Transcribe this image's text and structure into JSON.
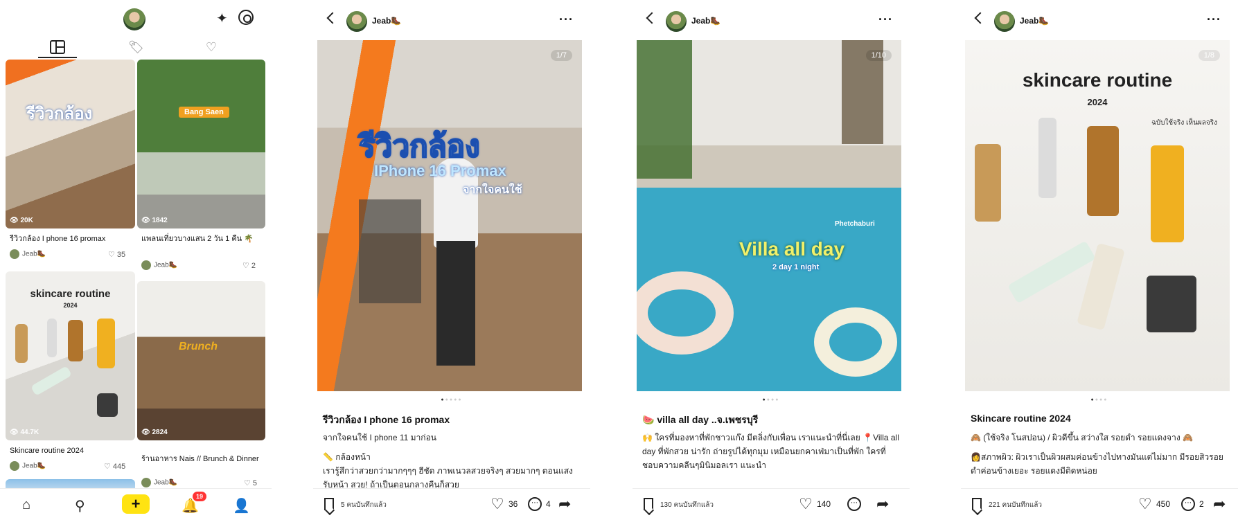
{
  "profile": {
    "tabs": [
      "grid-icon",
      "bookmark-icon",
      "heart-icon"
    ],
    "cards": [
      {
        "title": "รีวิวกล้อง I phone 16 promax",
        "author": "Jeab🥾",
        "likes": "35",
        "views": "20K",
        "overlay": "รีวิวกล้อง"
      },
      {
        "title": "แพลนเที่ยวบางแสน 2 วัน 1 คืน 🌴",
        "author": "Jeab🥾",
        "likes": "2",
        "views": "1842",
        "overlay": "Bang Saen"
      },
      {
        "title": "Skincare routine 2024",
        "author": "Jeab🥾",
        "likes": "445",
        "views": "44.7K",
        "overlay": "skincare routine",
        "overlay_sub": "2024"
      },
      {
        "title": "ร้านอาหาร Nais // Brunch & Dinner",
        "author": "Jeab🥾",
        "likes": "5",
        "views": "2824",
        "overlay": "Brunch"
      }
    ],
    "nav": {
      "badge": "19"
    }
  },
  "posts": [
    {
      "user": "Jeab🥾",
      "counter": "1/7",
      "overlay_main": "รีวิวกล้อง",
      "overlay_sub": "IPhone 16 Promax",
      "overlay_sub2": "จากใจคนใช้",
      "title": "รีวิวกล้อง I phone 16 promax",
      "body": [
        "จากใจคนใช้ I phone 11 มาก่อน",
        "📏 กล้องหน้า\nเรารู้สึกว่าสวยกว่ามากๆๆๆ ฮีชัด ภาพเนวลสวยจริงๆ สวยมากๆ ตอนแสงรับหน้า สวย! ถ้าเป็นตอนกลางคืนก็สวย"
      ],
      "saves": "5 คนบันทึกแล้ว",
      "likes": "36",
      "comments": "4"
    },
    {
      "user": "Jeab🥾",
      "counter": "1/10",
      "overlay_main": "Villa all day",
      "overlay_sub": "2 day 1 night",
      "overlay_tag": "Phetchaburi",
      "title": "🍉 villa all day ..จ.เพชรบุรี",
      "body": [
        "🙌 ใครที่มองหาที่พักชาวแก๊ง มีตลิ่งกับเพื่อน เราแนะนำที่นี่เลย 📍Villa all day ที่พักสวย น่ารัก ถ่ายรูปได้ทุกมุม เหมือนยกคาเฟ่มาเป็นที่พัก ใครที่ชอบความคลีนๆมินิมอลเรา แนะนำ"
      ],
      "saves": "130 คนบันทึกแล้ว",
      "likes": "140",
      "comments": ""
    },
    {
      "user": "Jeab🥾",
      "counter": "1/8",
      "overlay_main": "skincare routine",
      "overlay_sub": "2024",
      "overlay_note": "ฉบับใช้จริง เห็นผลจริง",
      "title": "Skincare routine 2024",
      "body": [
        "🙈 (ใช้จริง โนสปอน) / ผิวดีขึ้น สว่างใส รอยดำ รอยแดงจาง 🙈",
        "👩สภาพผิว: ผิวเราเป็นผิวผสมค่อนข้างไปทางมันแต่ไม่มาก มีรอยสิวรอยดำค่อนข้างเยอะ รอยแดงมีติดหน่อย"
      ],
      "saves": "221 คนบันทึกแล้ว",
      "likes": "450",
      "comments": "2"
    }
  ],
  "colors": {
    "accent_yellow": "#ffe312",
    "badge_red": "#ff3333"
  }
}
